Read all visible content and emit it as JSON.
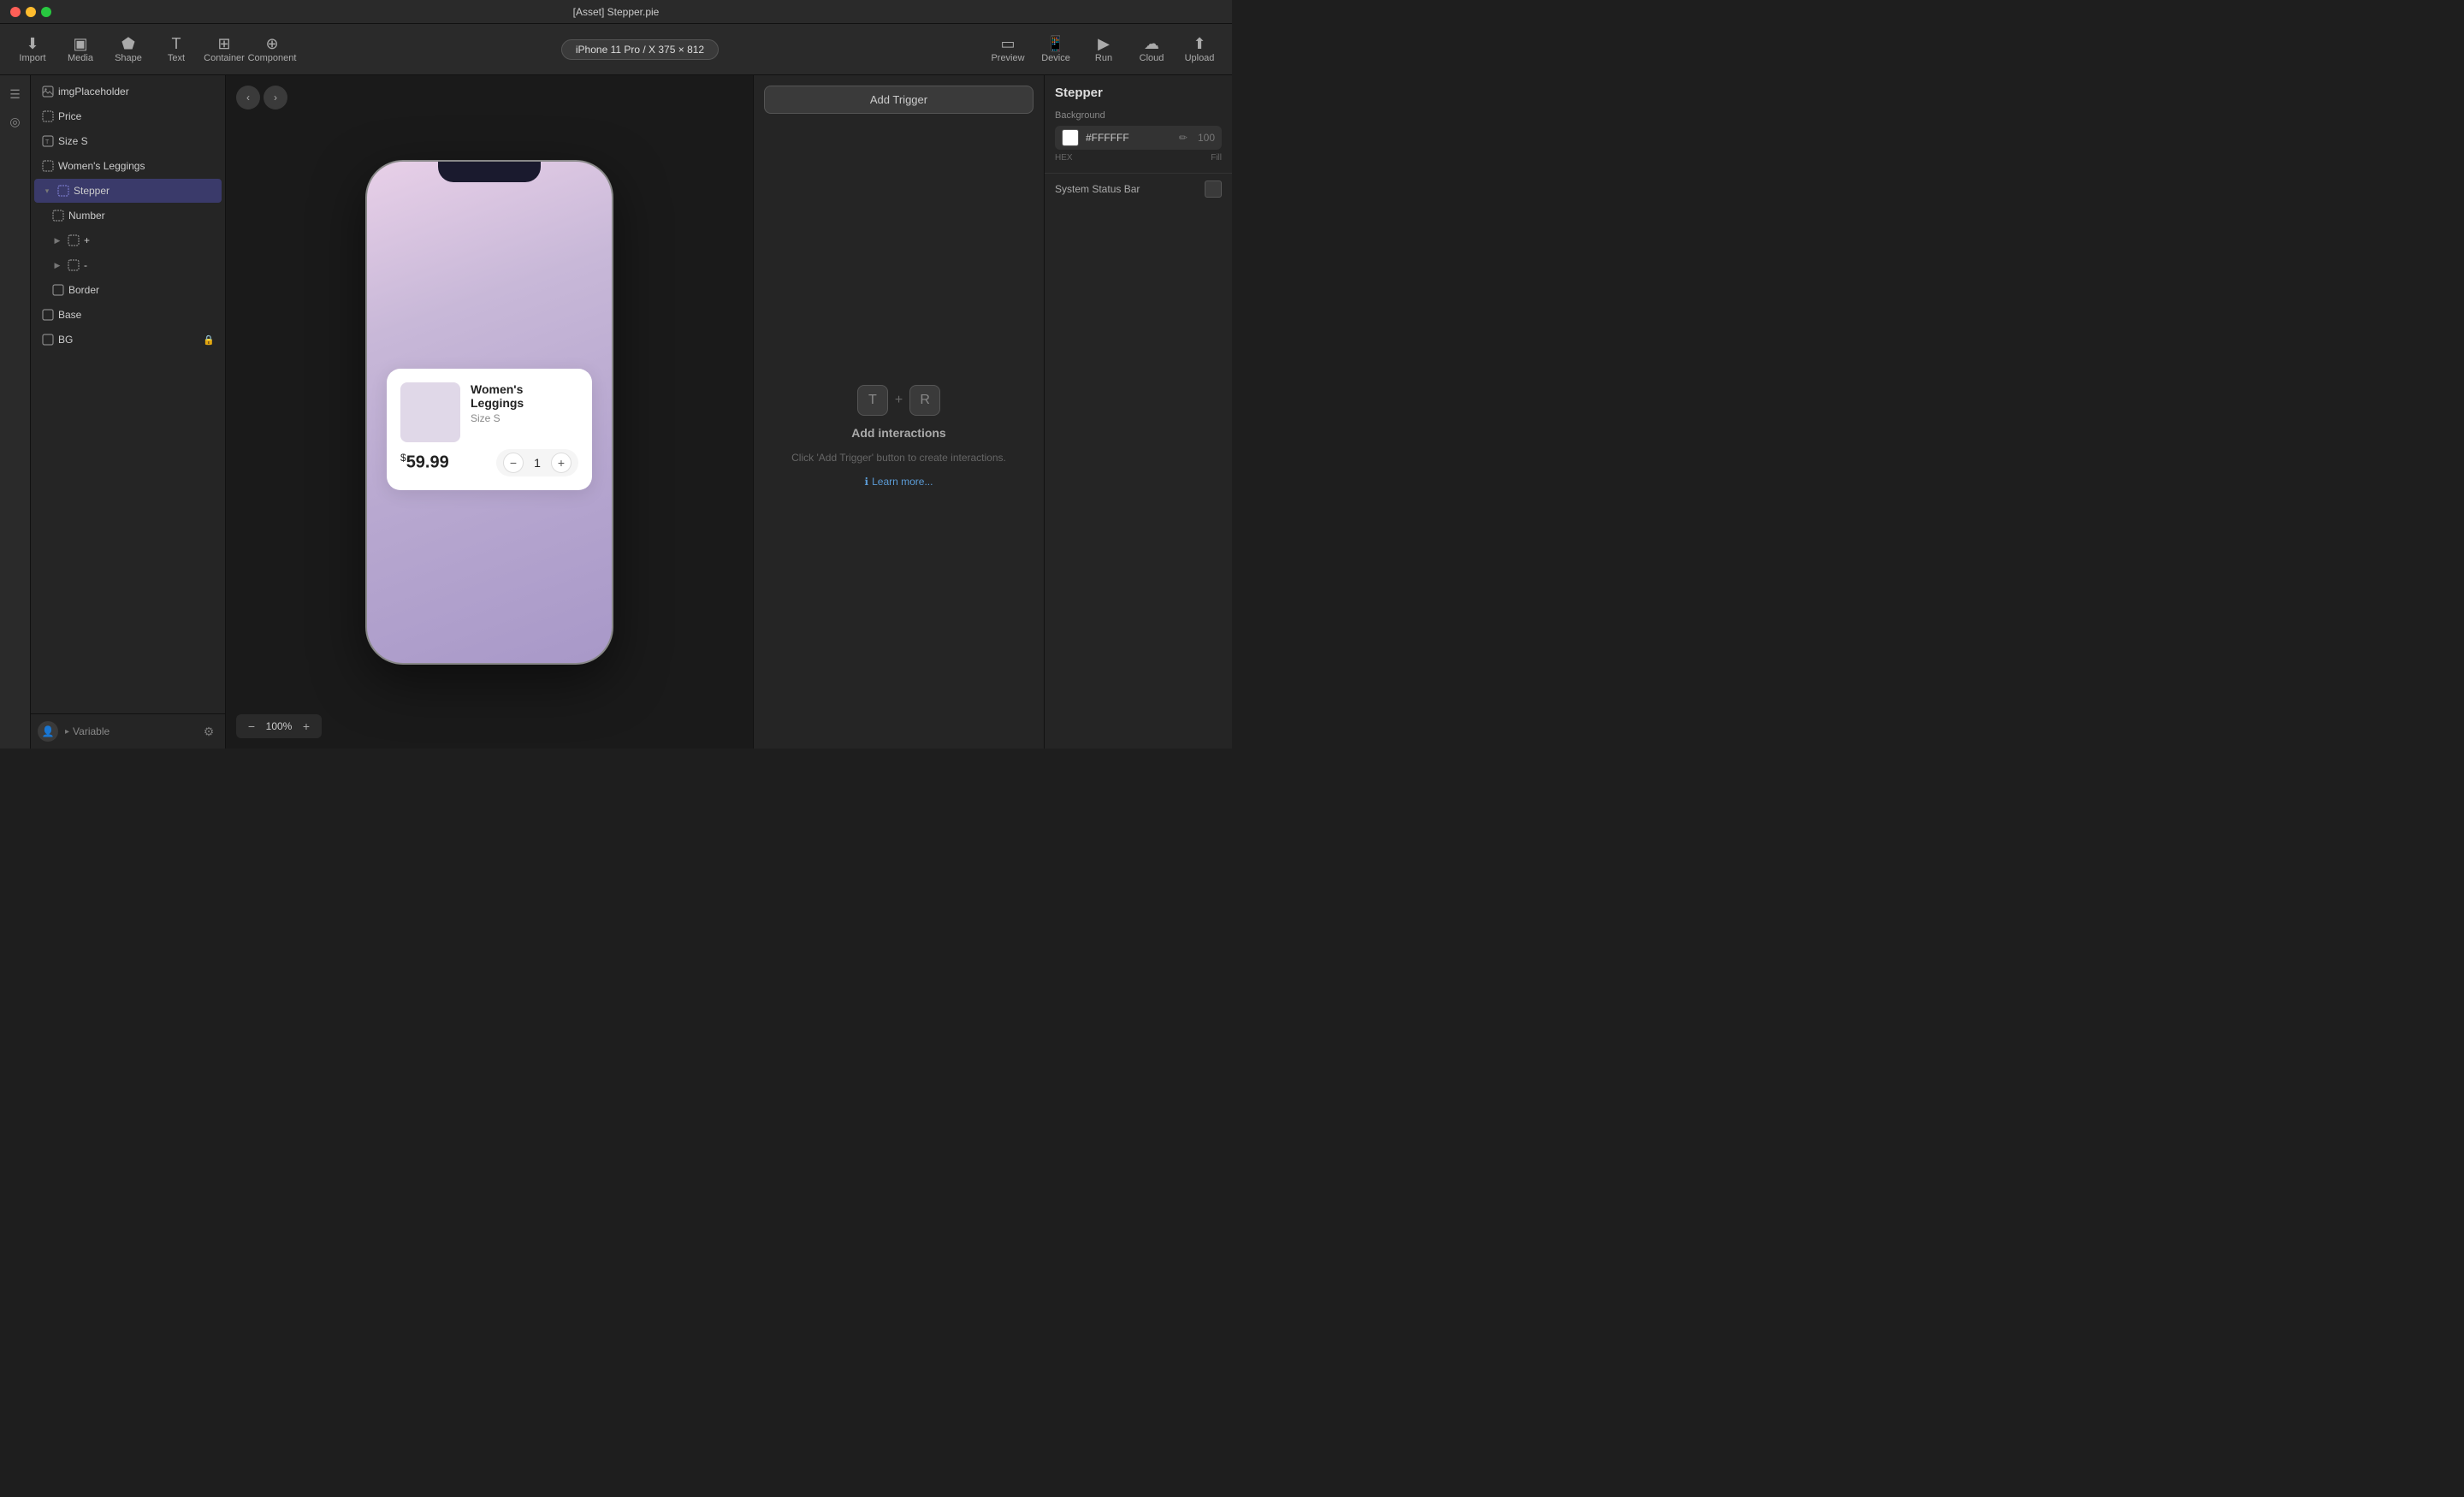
{
  "titlebar": {
    "title": "[Asset] Stepper.pie"
  },
  "toolbar": {
    "import_label": "Import",
    "media_label": "Media",
    "shape_label": "Shape",
    "text_label": "Text",
    "container_label": "Container",
    "component_label": "Component",
    "device_label": "iPhone 11 Pro / X  375 × 812",
    "preview_label": "Preview",
    "device_btn_label": "Device",
    "run_label": "Run",
    "cloud_label": "Cloud",
    "upload_label": "Upload"
  },
  "layers": {
    "items": [
      {
        "id": "imgPlaceholder",
        "name": "imgPlaceholder",
        "icon": "⊞",
        "indent": 0,
        "type": "image"
      },
      {
        "id": "price",
        "name": "Price",
        "icon": "⊞",
        "indent": 0,
        "type": "frame"
      },
      {
        "id": "sizeS",
        "name": "Size S",
        "icon": "T",
        "indent": 0,
        "type": "text"
      },
      {
        "id": "womensLeggings",
        "name": "Women's Leggings",
        "icon": "⊞",
        "indent": 0,
        "type": "frame"
      },
      {
        "id": "stepper",
        "name": "Stepper",
        "icon": "⊞",
        "indent": 0,
        "type": "frame",
        "expanded": true
      },
      {
        "id": "number",
        "name": "Number",
        "icon": "⊞",
        "indent": 1,
        "type": "frame"
      },
      {
        "id": "plus",
        "name": "+",
        "icon": "⊞",
        "indent": 1,
        "type": "frame",
        "hasChevron": true
      },
      {
        "id": "minus",
        "name": "-",
        "icon": "⊞",
        "indent": 1,
        "type": "frame",
        "hasChevron": true
      },
      {
        "id": "border",
        "name": "Border",
        "icon": "⊞",
        "indent": 1,
        "type": "image"
      },
      {
        "id": "base",
        "name": "Base",
        "icon": "⊞",
        "indent": 0,
        "type": "image"
      },
      {
        "id": "bg",
        "name": "BG",
        "icon": "⊞",
        "indent": 0,
        "type": "image",
        "locked": true
      }
    ],
    "footer": {
      "variable_label": "Variable"
    }
  },
  "canvas": {
    "zoom_label": "100%",
    "zoom_minus": "−",
    "zoom_plus": "+"
  },
  "phone": {
    "product": {
      "title": "Women's Leggings",
      "subtitle": "Size S",
      "price_symbol": "$",
      "price": "59.99",
      "stepper_value": "1",
      "stepper_minus": "−",
      "stepper_plus": "+"
    }
  },
  "interactions": {
    "add_trigger_label": "Add Trigger",
    "shortcut_t": "T",
    "shortcut_plus": "+",
    "shortcut_r": "R",
    "title": "Add interactions",
    "description": "Click 'Add Trigger' button\nto create interactions.",
    "learn_more": "Learn more..."
  },
  "properties": {
    "title": "Stepper",
    "background_label": "Background",
    "color_hex": "#FFFFFF",
    "color_fill": "100",
    "hex_label": "HEX",
    "fill_label": "Fill",
    "system_status_label": "System Status Bar"
  },
  "left_iconbar": {
    "icons": [
      "☰",
      "◎"
    ]
  }
}
